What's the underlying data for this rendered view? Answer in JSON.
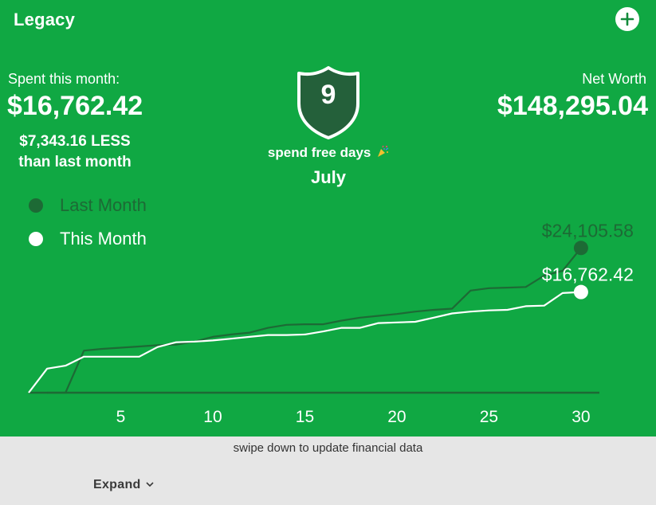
{
  "header": {
    "title": "Legacy",
    "add_icon": "plus-icon"
  },
  "spent": {
    "label": "Spent this month:",
    "value": "$16,762.42",
    "difference": "$7,343.16 LESS",
    "difference_suffix": "than last month"
  },
  "spend_free": {
    "days": "9",
    "label": "spend free days",
    "icon": "party-popper-icon",
    "month": "July"
  },
  "net_worth": {
    "label": "Net Worth",
    "value": "$148,295.04"
  },
  "legend": {
    "last_month": "Last Month",
    "this_month": "This Month"
  },
  "colors": {
    "background": "#10a843",
    "last_month": "#1d6a35",
    "this_month": "#ffffff",
    "shield": "#24603a"
  },
  "chart_data": {
    "type": "line",
    "title": "",
    "xlabel": "",
    "ylabel": "",
    "xlim": [
      0,
      31
    ],
    "ylim": [
      0,
      26000
    ],
    "x_ticks": [
      5,
      10,
      15,
      20,
      25,
      30
    ],
    "series": [
      {
        "name": "Last Month",
        "end_label": "$24,105.58",
        "points": [
          [
            1,
            0
          ],
          [
            2,
            0
          ],
          [
            3,
            7000
          ],
          [
            4,
            7300
          ],
          [
            5,
            7500
          ],
          [
            6,
            7700
          ],
          [
            7,
            7900
          ],
          [
            8,
            8000
          ],
          [
            9,
            8500
          ],
          [
            10,
            9300
          ],
          [
            11,
            9700
          ],
          [
            12,
            10000
          ],
          [
            13,
            10800
          ],
          [
            14,
            11300
          ],
          [
            15,
            11400
          ],
          [
            16,
            11400
          ],
          [
            17,
            12000
          ],
          [
            18,
            12500
          ],
          [
            19,
            12800
          ],
          [
            20,
            13100
          ],
          [
            21,
            13500
          ],
          [
            22,
            13800
          ],
          [
            23,
            14000
          ],
          [
            24,
            17000
          ],
          [
            25,
            17400
          ],
          [
            26,
            17500
          ],
          [
            27,
            17600
          ],
          [
            28,
            19500
          ],
          [
            29,
            20300
          ],
          [
            30,
            24105.58
          ]
        ]
      },
      {
        "name": "This Month",
        "end_label": "$16,762.42",
        "points": [
          [
            0,
            0
          ],
          [
            1,
            4000
          ],
          [
            2,
            4500
          ],
          [
            3,
            6000
          ],
          [
            4,
            6000
          ],
          [
            5,
            6000
          ],
          [
            6,
            6000
          ],
          [
            7,
            7600
          ],
          [
            8,
            8400
          ],
          [
            9,
            8500
          ],
          [
            10,
            8700
          ],
          [
            11,
            9000
          ],
          [
            12,
            9300
          ],
          [
            13,
            9600
          ],
          [
            14,
            9600
          ],
          [
            15,
            9700
          ],
          [
            16,
            10200
          ],
          [
            17,
            10800
          ],
          [
            18,
            10800
          ],
          [
            19,
            11600
          ],
          [
            20,
            11700
          ],
          [
            21,
            11800
          ],
          [
            22,
            12500
          ],
          [
            23,
            13200
          ],
          [
            24,
            13500
          ],
          [
            25,
            13700
          ],
          [
            26,
            13800
          ],
          [
            27,
            14400
          ],
          [
            28,
            14500
          ],
          [
            29,
            16600
          ],
          [
            30,
            16762.42
          ]
        ]
      }
    ]
  },
  "footer": {
    "refresh_hint": "swipe down to update financial data",
    "expand_label": "Expand",
    "expand_icon": "chevron-down-icon"
  }
}
